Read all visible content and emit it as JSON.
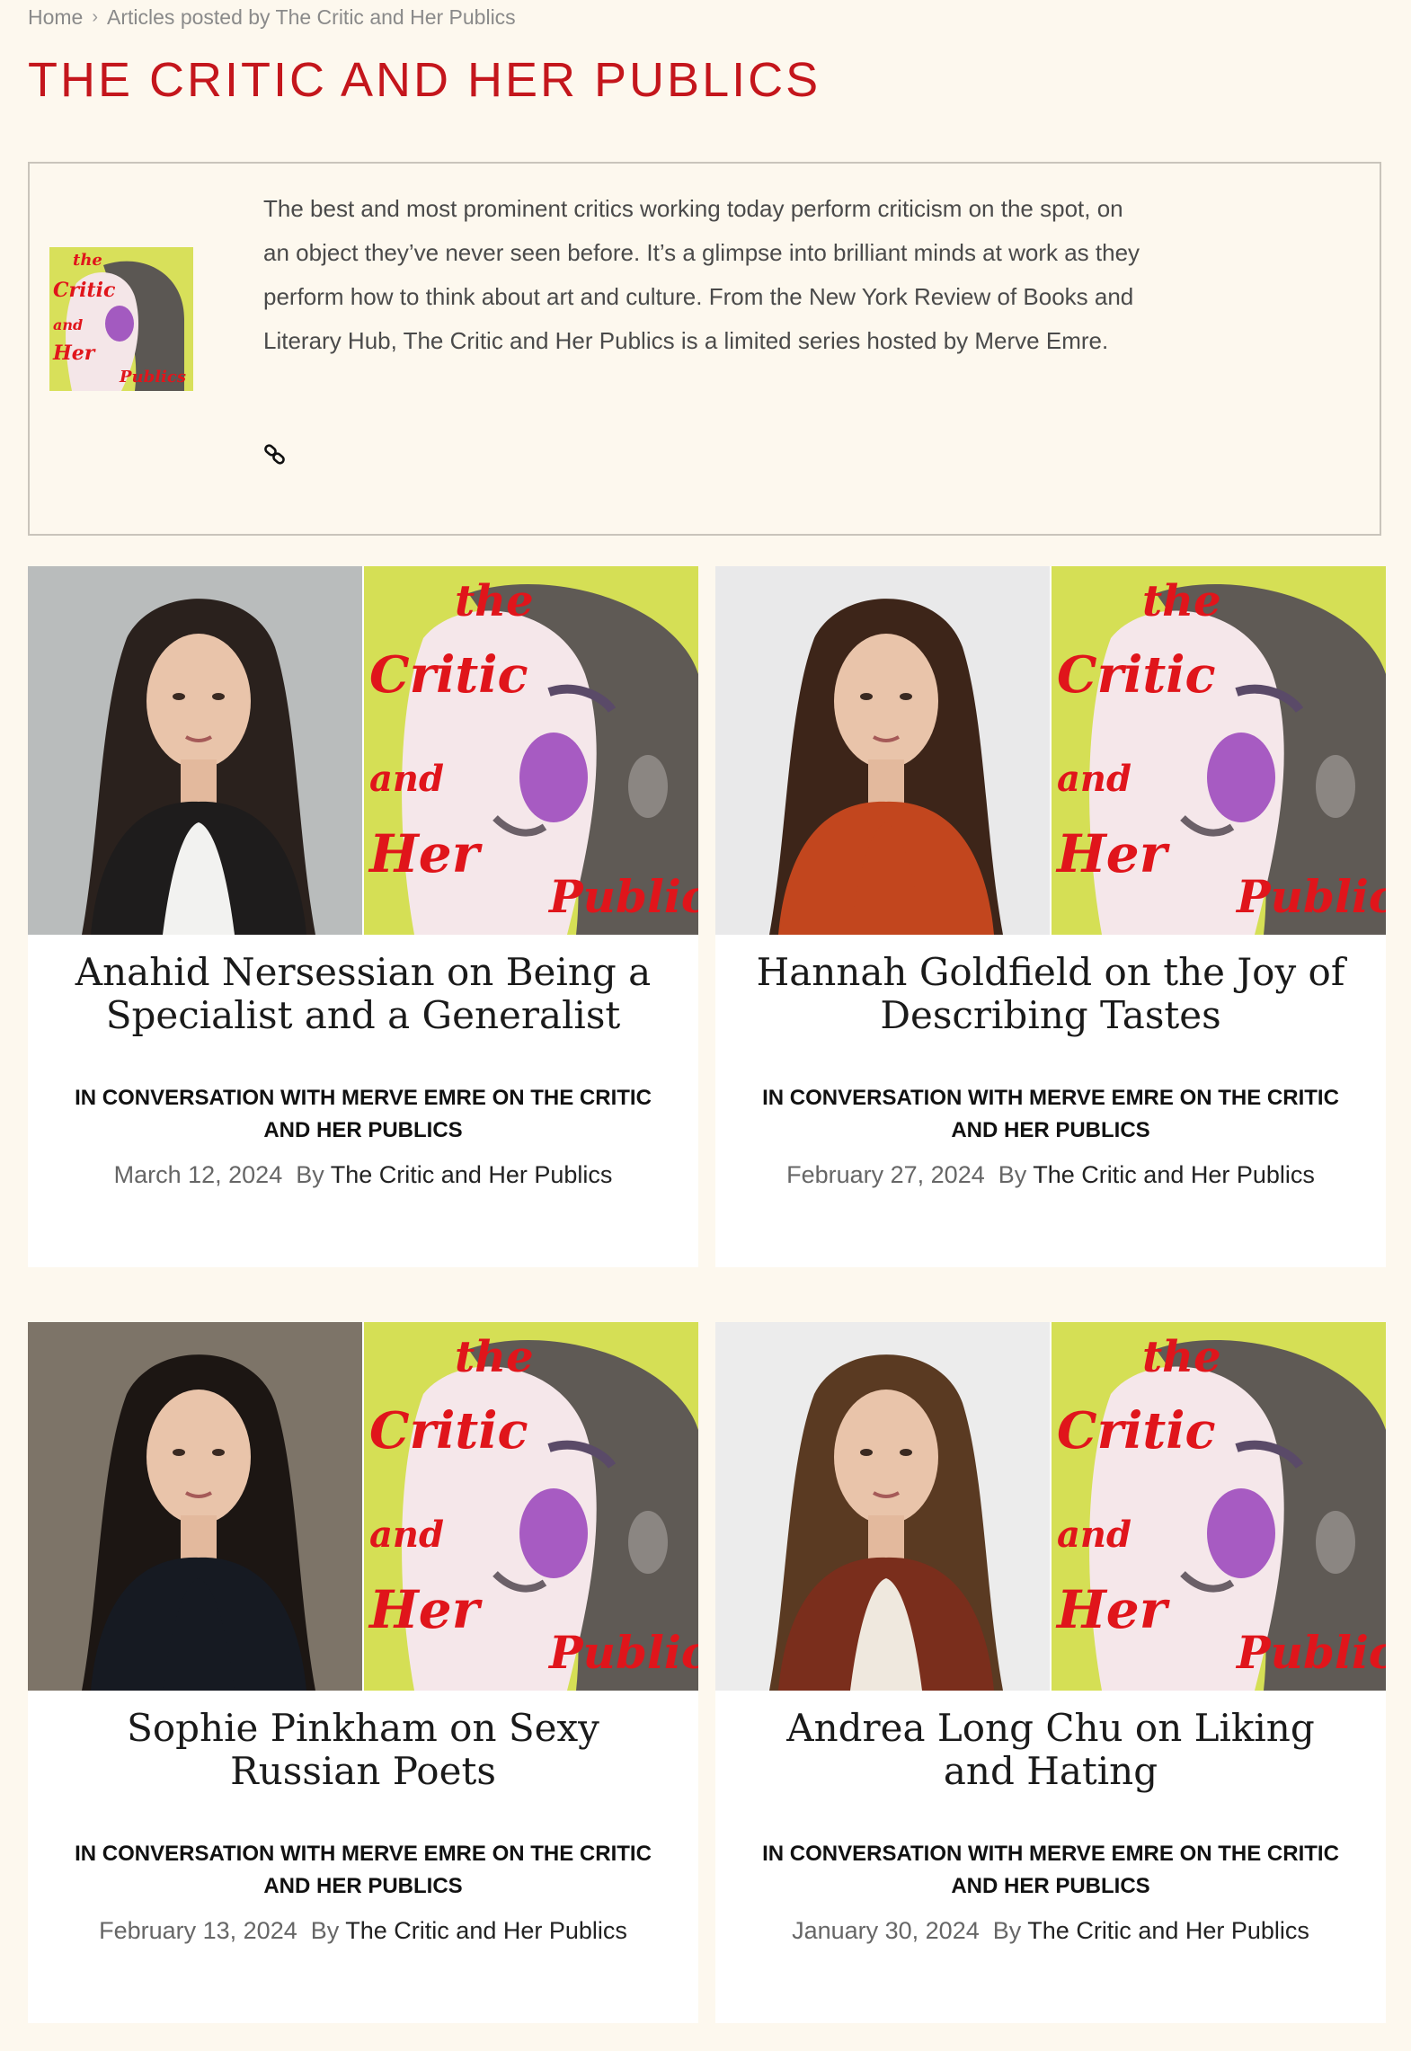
{
  "breadcrumb": {
    "home": "Home",
    "separator": "›",
    "current": "Articles posted by The Critic and Her Publics"
  },
  "page_title": "THE CRITIC AND HER PUBLICS",
  "author_box": {
    "description": "The best and most prominent critics working today perform criticism on the spot, on an object they’ve never seen before. It’s a glimpse into brilliant minds at work as they perform how to think about art and culture. From the New York Review of Books and Literary Hub, The Critic and Her Publics is a limited series hosted by Merve Emre.",
    "link_icon": "link-icon",
    "logo_lettering": [
      "the",
      "Critic",
      "and",
      "Her",
      "Publics"
    ]
  },
  "cover_art_lettering": [
    "the",
    "Critic",
    "and",
    "Her",
    "Public"
  ],
  "articles": [
    {
      "title": "Anahid Nersessian on Being a Specialist and a Generalist",
      "kicker": "In Conversation with Merve Emre on The Critic and Her Publics",
      "date": "March 12, 2024",
      "by": "By",
      "author": "The Critic and Her Publics",
      "photo_bg": "#b9bcbc",
      "hair": "#2a211d",
      "top": "#f2f2f0",
      "jacket": "#1e1c1c"
    },
    {
      "title": "Hannah Goldfield on the Joy of Describing Tastes",
      "kicker": "In Conversation with Merve Emre on The Critic and Her Publics",
      "date": "February 27, 2024",
      "by": "By",
      "author": "The Critic and Her Publics",
      "photo_bg": "#e9e9ea",
      "hair": "#3d2519",
      "top": "#c2461e",
      "jacket": "#c2461e"
    },
    {
      "title": "Sophie Pinkham on Sexy Russian Poets",
      "kicker": "In Conversation with Merve Emre on The Critic and Her Publics",
      "date": "February 13, 2024",
      "by": "By",
      "author": "The Critic and Her Publics",
      "photo_bg": "#7d7468",
      "hair": "#1c1613",
      "top": "#161a22",
      "jacket": "#161a22"
    },
    {
      "title": "Andrea Long Chu on Liking and Hating",
      "kicker": "In Conversation with Merve Emre on The Critic and Her Publics",
      "date": "January 30, 2024",
      "by": "By",
      "author": "The Critic and Her Publics",
      "photo_bg": "#ececec",
      "hair": "#5a3a22",
      "top": "#efe8de",
      "jacket": "#7a2e1c"
    }
  ]
}
